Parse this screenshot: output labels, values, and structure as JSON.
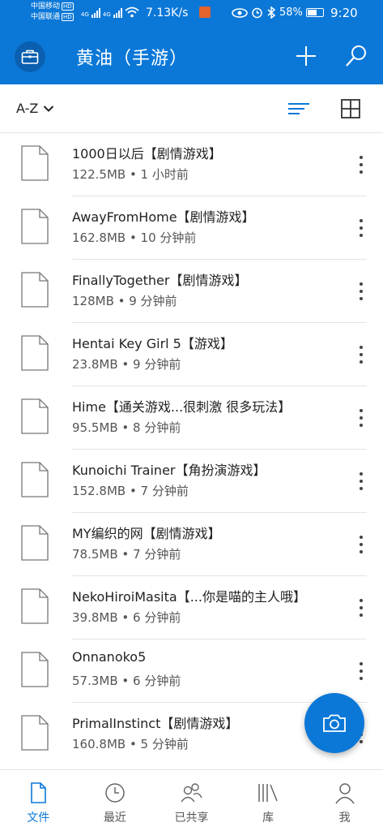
{
  "status_bar": {
    "carrier1": "中国移动",
    "carrier2": "中国联通",
    "hd": "HD",
    "net1": "4G",
    "net2": "4G",
    "speed": "7.13K/s",
    "battery": "58%",
    "time": "9:20"
  },
  "header": {
    "title": "黄油（手游）",
    "left_icon": "briefcase-icon",
    "add_icon": "plus-icon",
    "search_icon": "search-icon",
    "accent": "#0b78d8"
  },
  "toolbar": {
    "sort_label": "A-Z"
  },
  "files": [
    {
      "name": "1000日以后【剧情游戏】",
      "meta": "122.5MB • 1 小时前"
    },
    {
      "name": "AwayFromHome【剧情游戏】",
      "meta": "162.8MB • 10 分钟前"
    },
    {
      "name": "FinallyTogether【剧情游戏】",
      "meta": "128MB • 9 分钟前"
    },
    {
      "name": "Hentai Key Girl 5【游戏】",
      "meta": "23.8MB • 9 分钟前"
    },
    {
      "name": "Hime【通关游戏...很刺激 很多玩法】",
      "meta": "95.5MB • 8 分钟前"
    },
    {
      "name": "Kunoichi Trainer【角扮演游戏】",
      "meta": "152.8MB • 7 分钟前"
    },
    {
      "name": "MY编织的网【剧情游戏】",
      "meta": "78.5MB • 7 分钟前"
    },
    {
      "name": "NekoHiroiMasita【...你是喵的主人哦】",
      "meta": "39.8MB • 6 分钟前"
    },
    {
      "name": "Onnanoko5",
      "meta": "57.3MB • 6 分钟前"
    },
    {
      "name": "PrimalInstinct【剧情游戏】",
      "meta": "160.8MB • 5 分钟前"
    }
  ],
  "bottom_nav": [
    {
      "label": "文件",
      "icon": "file-icon",
      "active": true
    },
    {
      "label": "最近",
      "icon": "clock-icon",
      "active": false
    },
    {
      "label": "已共享",
      "icon": "people-icon",
      "active": false
    },
    {
      "label": "库",
      "icon": "library-icon",
      "active": false
    },
    {
      "label": "我",
      "icon": "person-icon",
      "active": false
    }
  ]
}
